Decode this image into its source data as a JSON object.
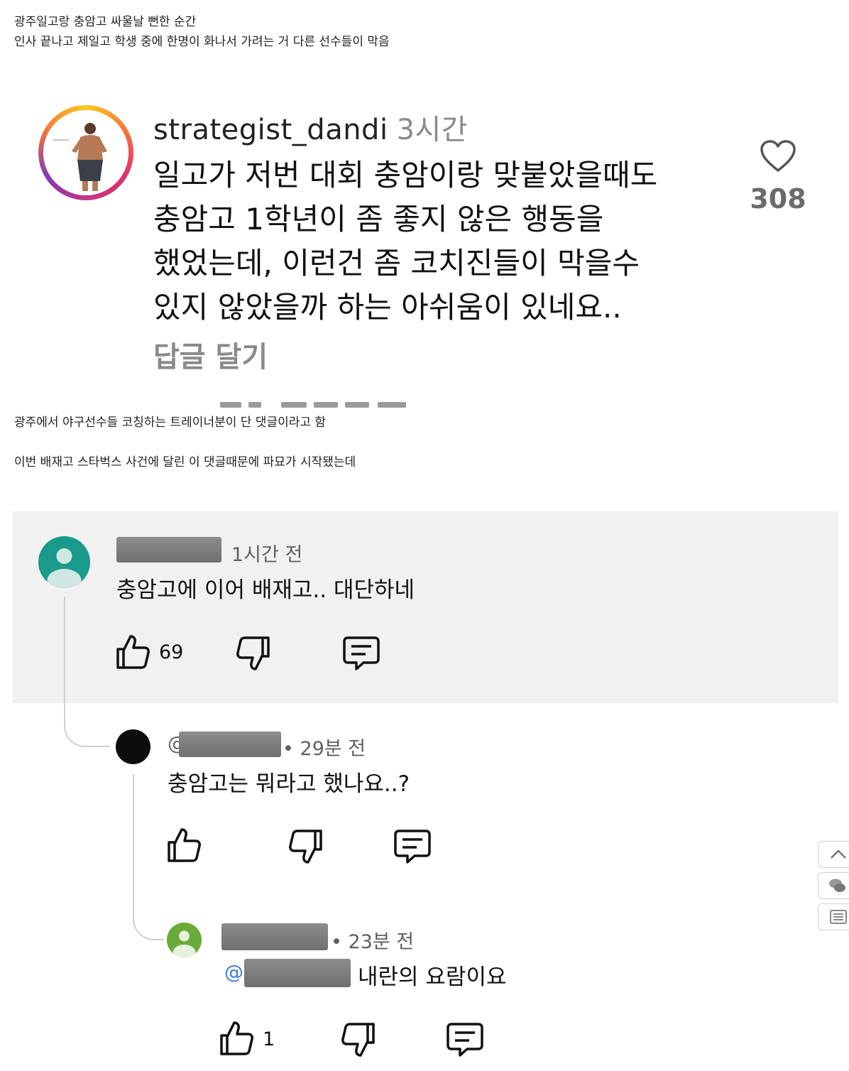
{
  "post": {
    "caption_line1": "광주일고랑 충암고 싸울날 뻔한 순간",
    "caption_line2": "인사 끝나고 제일고 학생 중에 한명이 화나서 가려는 거 다른 선수들이 막음",
    "caption_line3": "광주에서 야구선수들 코칭하는 트레이너분이 단 댓글이라고 함",
    "caption_line4": "이번 배재고 스타벅스 사건에 달린 이 댓글때문에 파묘가 시작됐는데"
  },
  "instagram": {
    "username": "strategist_dandi",
    "time": "3시간",
    "comment_lines": [
      "일고가 저번 대회 충암이랑 맞붙았을때도",
      "충암고 1학년이 좀 좋지 않은 행동을",
      "했었는데, 이런건 좀 코치진들이 막을수",
      "있지 않았을까 하는 아쉬움이 있네요.."
    ],
    "reply_label": "답글 달기",
    "like_count": "308",
    "heart_icon": "heart-outline-icon"
  },
  "comments": {
    "first": {
      "time": "1시간 전",
      "text": "충암고에 이어 배재고.. 대단하네",
      "like_count": "69",
      "avatar_color": "#1a9a8a"
    },
    "reply1": {
      "handle_prefix": "@",
      "time": "29분 전",
      "text": "충암고는 뭐라고 했나요..?",
      "avatar_color": "#0d0d0d"
    },
    "reply2": {
      "time": "23분 전",
      "mention_prefix": "@",
      "text": "내란의 요람이요",
      "like_count": "1",
      "avatar_color": "#6aaa3a"
    }
  },
  "colors": {
    "panel_bg": "#f1f1f1",
    "meta": "#606060",
    "mention": "#3d7ad6"
  }
}
